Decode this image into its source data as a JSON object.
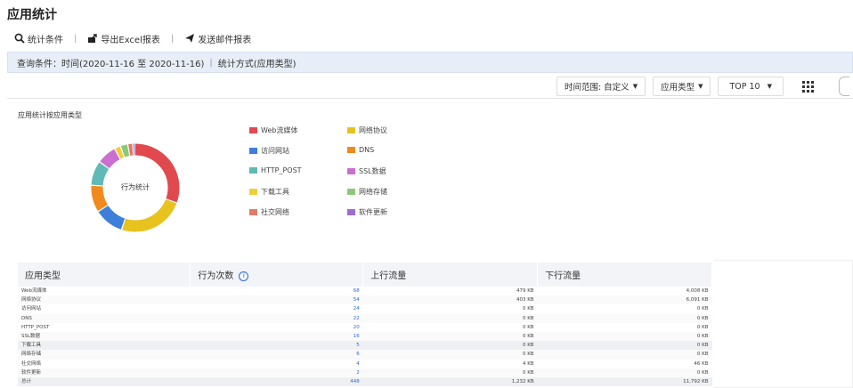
{
  "page": {
    "title": "应用统计"
  },
  "toolbar": {
    "condition_label": "统计条件",
    "export_label": "导出Excel报表",
    "email_label": "发送邮件报表"
  },
  "query": {
    "time_text": "查询条件：时间(2020-11-16 至 2020-11-16)",
    "method_text": "统计方式(应用类型)"
  },
  "filters": {
    "time_range": "时间范围: 自定义",
    "app_type": "应用类型",
    "top": "TOP 10"
  },
  "chart": {
    "title": "应用统计按应用类型",
    "center_label": "行为统计"
  },
  "chart_data": {
    "type": "pie",
    "title": "应用统计按应用类型",
    "categories": [
      "Web流媒体",
      "网络协议",
      "访问网站",
      "DNS",
      "HTTP_POST",
      "SSL数据",
      "下载工具",
      "网络存储",
      "社交网络",
      "软件更新"
    ],
    "values": [
      68,
      54,
      24,
      22,
      20,
      16,
      5,
      6,
      4,
      2
    ],
    "colors": [
      "#e0494e",
      "#e8c21e",
      "#3d7fd9",
      "#f08a1c",
      "#5fb9b5",
      "#c96fcf",
      "#f0ce3b",
      "#8bc878",
      "#e07b68",
      "#9f6ccf"
    ],
    "center_label": "行为统计",
    "legend_position": "right"
  },
  "legend": [
    {
      "label": "Web流媒体",
      "color": "#e0494e"
    },
    {
      "label": "网络协议",
      "color": "#e8c21e"
    },
    {
      "label": "访问网站",
      "color": "#3d7fd9"
    },
    {
      "label": "DNS",
      "color": "#f08a1c"
    },
    {
      "label": "HTTP_POST",
      "color": "#5fb9b5"
    },
    {
      "label": "SSL数据",
      "color": "#c96fcf"
    },
    {
      "label": "下载工具",
      "color": "#f0ce3b"
    },
    {
      "label": "网络存储",
      "color": "#8bc878"
    },
    {
      "label": "社交网络",
      "color": "#e07b68"
    },
    {
      "label": "软件更新",
      "color": "#9f6ccf"
    }
  ],
  "table": {
    "headers": [
      "应用类型",
      "行为次数",
      "上行流量",
      "下行流量"
    ],
    "rows": [
      [
        "Web流媒体",
        "68",
        "479 KB",
        "4,008 KB"
      ],
      [
        "网络协议",
        "54",
        "403 KB",
        "6,091 KB"
      ],
      [
        "访问网站",
        "24",
        "0 KB",
        "0 KB"
      ],
      [
        "DNS",
        "22",
        "0 KB",
        "0 KB"
      ],
      [
        "HTTP_POST",
        "20",
        "0 KB",
        "0 KB"
      ],
      [
        "SSL数据",
        "16",
        "0 KB",
        "0 KB"
      ],
      [
        "下载工具",
        "5",
        "0 KB",
        "0 KB"
      ],
      [
        "网络存储",
        "6",
        "0 KB",
        "0 KB"
      ],
      [
        "社交网络",
        "4",
        "4 KB",
        "46 KB"
      ],
      [
        "软件更新",
        "2",
        "0 KB",
        "0 KB"
      ],
      [
        "总计",
        "448",
        "1,232 KB",
        "11,792 KB"
      ]
    ]
  }
}
